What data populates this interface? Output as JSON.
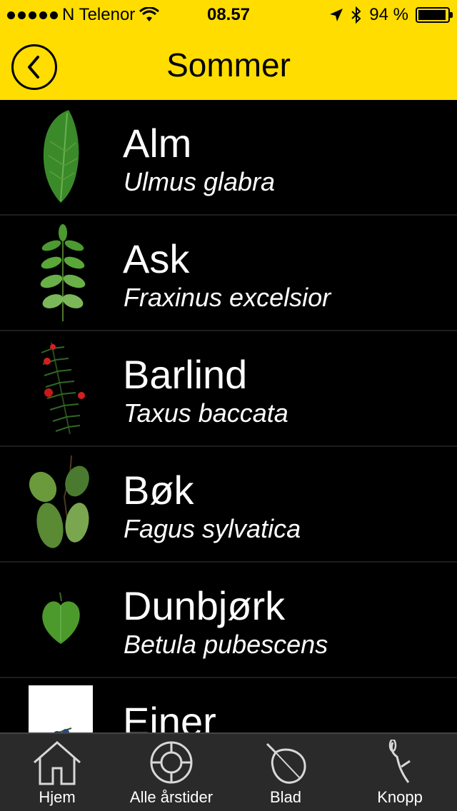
{
  "status_bar": {
    "carrier": "N Telenor",
    "time": "08.57",
    "battery": "94 %",
    "battery_level": 0.94
  },
  "nav": {
    "title": "Sommer",
    "back_icon": "chevron-left-icon"
  },
  "list": {
    "items": [
      {
        "name": "Alm",
        "latin": "Ulmus glabra",
        "icon": "elm-leaf-icon"
      },
      {
        "name": "Ask",
        "latin": "Fraxinus excelsior",
        "icon": "ash-leaf-icon"
      },
      {
        "name": "Barlind",
        "latin": "Taxus baccata",
        "icon": "yew-branch-icon"
      },
      {
        "name": "Bøk",
        "latin": "Fagus sylvatica",
        "icon": "beech-leaves-icon"
      },
      {
        "name": "Dunbjørk",
        "latin": "Betula pubescens",
        "icon": "birch-leaf-icon"
      },
      {
        "name": "Einer",
        "latin": "",
        "icon": "juniper-icon"
      }
    ]
  },
  "tabbar": {
    "tabs": [
      {
        "label": "Hjem",
        "icon": "house-icon"
      },
      {
        "label": "Alle årstider",
        "icon": "seasons-icon"
      },
      {
        "label": "Blad",
        "icon": "leaf-icon"
      },
      {
        "label": "Knopp",
        "icon": "bud-icon"
      }
    ]
  },
  "colors": {
    "header": "#FFDD00",
    "background": "#000000",
    "tabbar": "#2A2A2A",
    "text": "#FFFFFF"
  }
}
